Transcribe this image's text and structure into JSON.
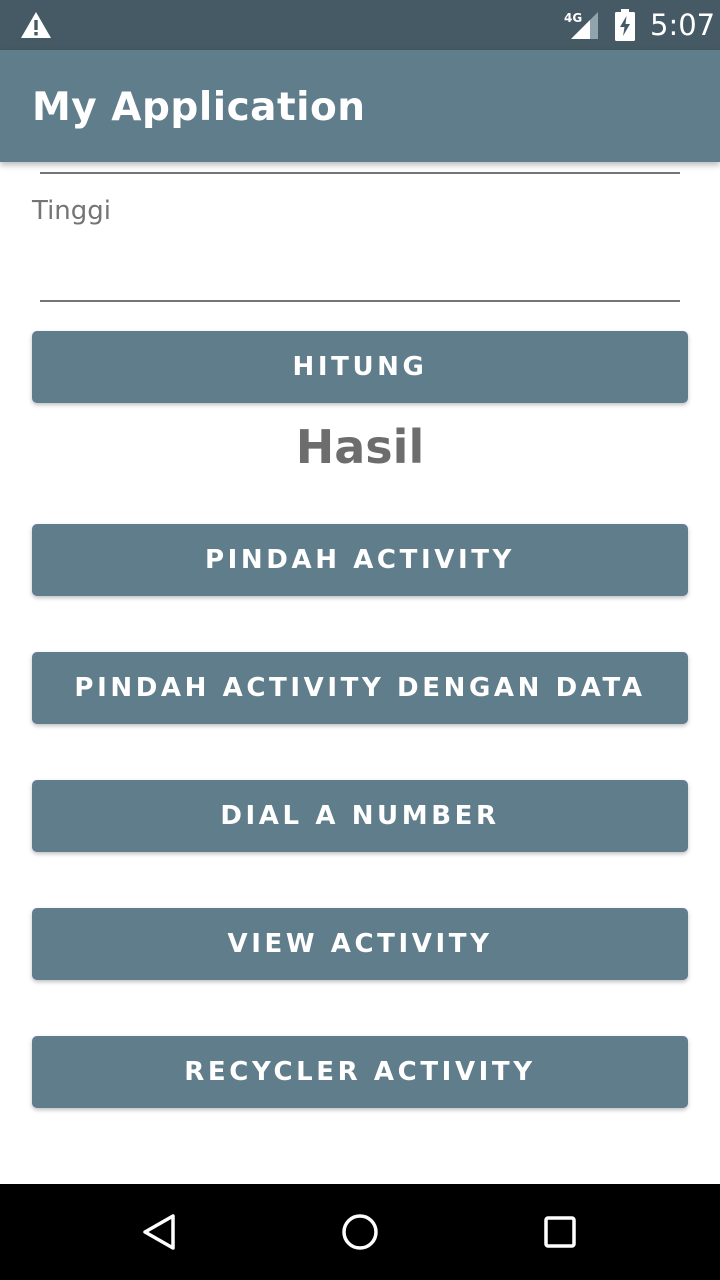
{
  "status_bar": {
    "network": "4G",
    "time": "5:07",
    "icons": [
      "warning-icon",
      "signal-icon",
      "battery-charging-icon"
    ]
  },
  "app_bar": {
    "title": "My Application"
  },
  "form": {
    "height_field": {
      "hint": "Tinggi",
      "value": ""
    },
    "calculate_button": "HITUNG",
    "result_label": "Hasil"
  },
  "buttons": {
    "move_activity": "PINDAH ACTIVITY",
    "move_activity_with_data": "PINDAH ACTIVITY DENGAN DATA",
    "dial_number": "DIAL A NUMBER",
    "view_activity": "VIEW ACTIVITY",
    "recycler_activity": "RECYCLER ACTIVITY"
  },
  "nav_bar": {
    "icons": [
      "back-icon",
      "home-icon",
      "recents-icon"
    ]
  },
  "colors": {
    "status_bar": "#455a64",
    "primary": "#607d8b",
    "result_text": "#6d6d6d"
  }
}
